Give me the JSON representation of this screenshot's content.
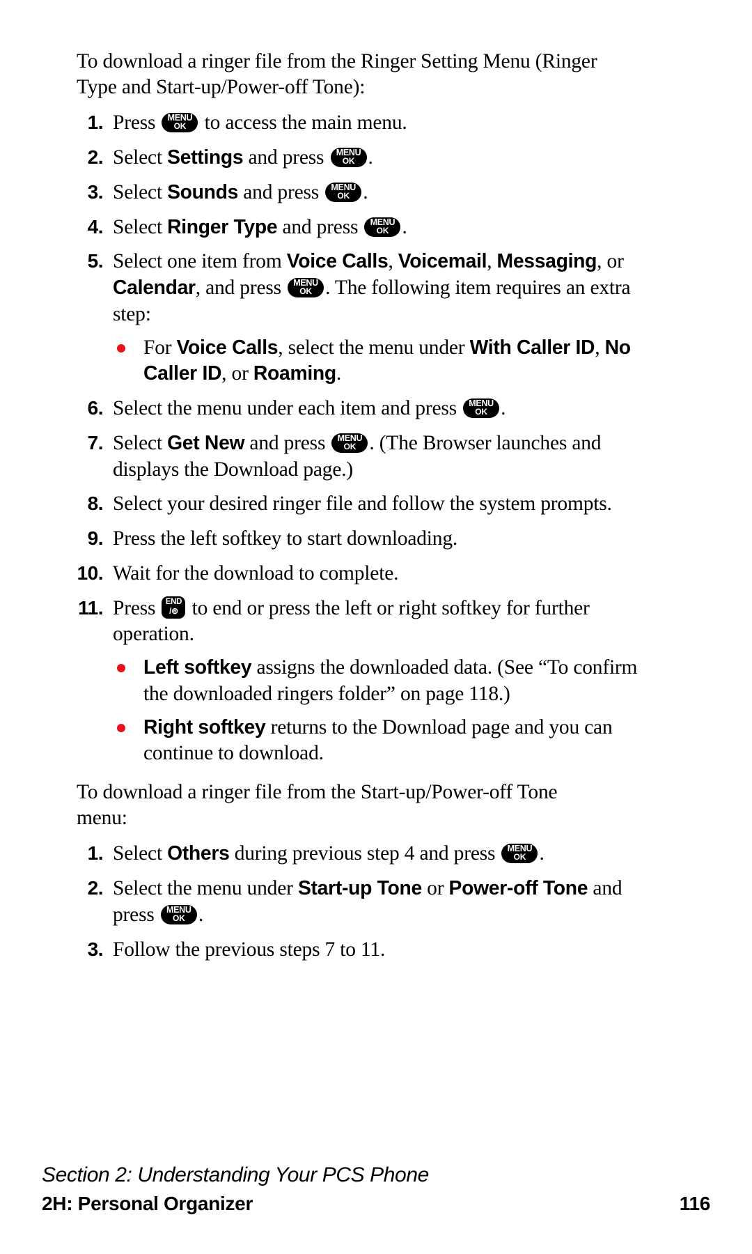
{
  "document": {
    "type": "phone-user-manual-page",
    "accent_red": "#e8131a",
    "text_color": "#000000",
    "background": "#ffffff"
  },
  "keys": {
    "menu": {
      "line1": "MENU",
      "line2": "OK"
    },
    "end": {
      "line1": "END",
      "line2": "/⊚"
    }
  },
  "section_one": {
    "intro": "To download a ringer file from the Ringer Setting Menu (Ringer Type and Start-up/Power-off Tone):",
    "steps": [
      {
        "num": "1.",
        "parts": [
          {
            "t": "text",
            "v": "Press "
          },
          {
            "t": "key-menu"
          },
          {
            "t": "text",
            "v": " to access the main menu."
          }
        ]
      },
      {
        "num": "2.",
        "parts": [
          {
            "t": "text",
            "v": "Select "
          },
          {
            "t": "ui",
            "v": "Settings"
          },
          {
            "t": "text",
            "v": " and press "
          },
          {
            "t": "key-menu"
          },
          {
            "t": "text",
            "v": "."
          }
        ]
      },
      {
        "num": "3.",
        "parts": [
          {
            "t": "text",
            "v": "Select "
          },
          {
            "t": "ui",
            "v": "Sounds"
          },
          {
            "t": "text",
            "v": " and press "
          },
          {
            "t": "key-menu"
          },
          {
            "t": "text",
            "v": "."
          }
        ]
      },
      {
        "num": "4.",
        "parts": [
          {
            "t": "text",
            "v": "Select "
          },
          {
            "t": "ui",
            "v": "Ringer Type"
          },
          {
            "t": "text",
            "v": " and press "
          },
          {
            "t": "key-menu"
          },
          {
            "t": "text",
            "v": "."
          }
        ]
      },
      {
        "num": "5.",
        "parts": [
          {
            "t": "text",
            "v": "Select one item from "
          },
          {
            "t": "ui",
            "v": "Voice Calls"
          },
          {
            "t": "text",
            "v": ", "
          },
          {
            "t": "ui",
            "v": "Voicemail"
          },
          {
            "t": "text",
            "v": ", "
          },
          {
            "t": "ui",
            "v": "Messaging"
          },
          {
            "t": "text",
            "v": ", or "
          },
          {
            "t": "ui",
            "v": "Calendar"
          },
          {
            "t": "text",
            "v": ", and press "
          },
          {
            "t": "key-menu"
          },
          {
            "t": "text",
            "v": ". The following item requires an extra step:"
          }
        ],
        "bullets": [
          {
            "parts": [
              {
                "t": "text",
                "v": "For "
              },
              {
                "t": "ui",
                "v": "Voice Calls"
              },
              {
                "t": "text",
                "v": ", select the menu under "
              },
              {
                "t": "ui",
                "v": "With Caller ID"
              },
              {
                "t": "text",
                "v": ", "
              },
              {
                "t": "ui",
                "v": "No Caller ID"
              },
              {
                "t": "text",
                "v": ", or "
              },
              {
                "t": "ui",
                "v": "Roaming"
              },
              {
                "t": "text",
                "v": "."
              }
            ]
          }
        ]
      },
      {
        "num": "6.",
        "parts": [
          {
            "t": "text",
            "v": "Select the menu under each item and press "
          },
          {
            "t": "key-menu"
          },
          {
            "t": "text",
            "v": "."
          }
        ]
      },
      {
        "num": "7.",
        "parts": [
          {
            "t": "text",
            "v": "Select "
          },
          {
            "t": "ui",
            "v": "Get New"
          },
          {
            "t": "text",
            "v": " and press "
          },
          {
            "t": "key-menu"
          },
          {
            "t": "text",
            "v": ". (The Browser launches and displays the Download page.)"
          }
        ]
      },
      {
        "num": "8.",
        "parts": [
          {
            "t": "text",
            "v": "Select your desired ringer file and follow the system prompts."
          }
        ]
      },
      {
        "num": "9.",
        "parts": [
          {
            "t": "text",
            "v": "Press the left softkey to start downloading."
          }
        ]
      },
      {
        "num": "10.",
        "parts": [
          {
            "t": "text",
            "v": "Wait for the download to complete."
          }
        ]
      },
      {
        "num": "11.",
        "parts": [
          {
            "t": "text",
            "v": "Press "
          },
          {
            "t": "key-end"
          },
          {
            "t": "text",
            "v": " to end or press the left or right softkey for further operation."
          }
        ],
        "bullets": [
          {
            "parts": [
              {
                "t": "ui",
                "v": "Left softkey"
              },
              {
                "t": "text",
                "v": " assigns the downloaded data. (See “To confirm the downloaded ringers folder” on page 118.)"
              }
            ]
          },
          {
            "parts": [
              {
                "t": "ui",
                "v": "Right softkey"
              },
              {
                "t": "text",
                "v": " returns to the Download page and you can continue to download."
              }
            ]
          }
        ]
      }
    ]
  },
  "section_two": {
    "intro": "To download a ringer file from the Start-up/Power-off Tone menu:",
    "steps": [
      {
        "num": "1.",
        "parts": [
          {
            "t": "text",
            "v": "Select "
          },
          {
            "t": "ui",
            "v": "Others"
          },
          {
            "t": "text",
            "v": " during previous step 4 and press "
          },
          {
            "t": "key-menu"
          },
          {
            "t": "text",
            "v": "."
          }
        ]
      },
      {
        "num": "2.",
        "parts": [
          {
            "t": "text",
            "v": "Select the menu under "
          },
          {
            "t": "ui",
            "v": "Start-up Tone"
          },
          {
            "t": "text",
            "v": " or "
          },
          {
            "t": "ui",
            "v": "Power-off Tone"
          },
          {
            "t": "text",
            "v": " and press "
          },
          {
            "t": "key-menu"
          },
          {
            "t": "text",
            "v": "."
          }
        ]
      },
      {
        "num": "3.",
        "parts": [
          {
            "t": "text",
            "v": "Follow the previous steps 7 to 11."
          }
        ]
      }
    ]
  },
  "footer": {
    "section_label": "Section 2: Understanding Your PCS Phone",
    "chapter_label": "2H: Personal Organizer",
    "page_number": "116"
  }
}
